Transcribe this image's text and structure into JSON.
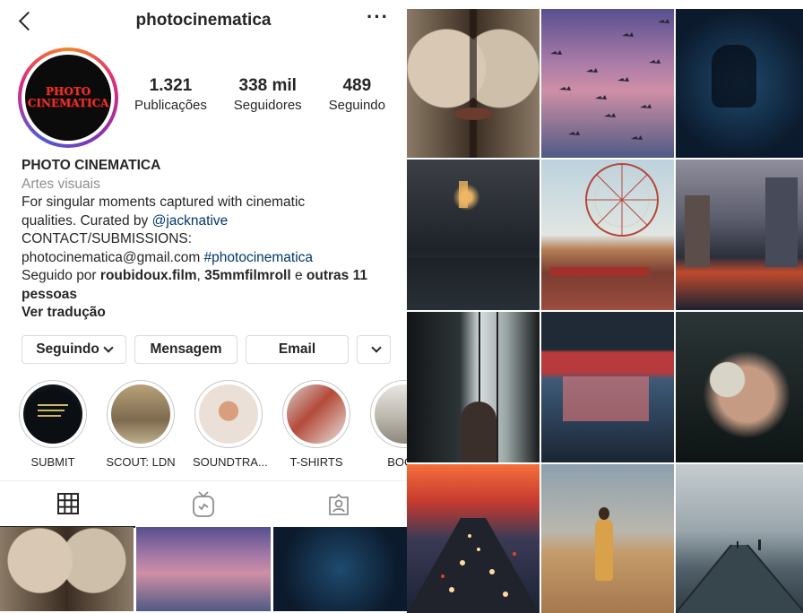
{
  "header": {
    "username": "photocinematica",
    "more_label": "···"
  },
  "avatar": {
    "logo_line1": "PHOTO",
    "logo_line2": "CINEMATICA"
  },
  "stats": [
    {
      "value": "1.321",
      "label": "Publicações"
    },
    {
      "value": "338 mil",
      "label": "Seguidores"
    },
    {
      "value": "489",
      "label": "Seguindo"
    }
  ],
  "bio": {
    "name": "PHOTO CINEMATICA",
    "category": "Artes visuais",
    "line1": "For singular moments captured with cinematic",
    "line2_prefix": "qualities. Curated by ",
    "mention": "@jacknative",
    "line3": "CONTACT/SUBMISSIONS:",
    "email": "photocinematica@gmail.com ",
    "hashtag": "#photocinematica",
    "followed_prefix": "Seguido por ",
    "follower1": "roubidoux.film",
    "sep": ", ",
    "follower2": "35mmfilmroll",
    "and": " e ",
    "others": "outras 11 pessoas",
    "translate": "Ver tradução"
  },
  "buttons": {
    "following": "Seguindo",
    "message": "Mensagem",
    "email": "Email"
  },
  "highlights": [
    {
      "label": "SUBMIT"
    },
    {
      "label": "SCOUT: LDN"
    },
    {
      "label": "SOUNDTRA..."
    },
    {
      "label": "T-SHIRTS"
    },
    {
      "label": "BOOK"
    }
  ],
  "tabs": [
    {
      "icon": "grid-icon"
    },
    {
      "icon": "igtv-icon"
    },
    {
      "icon": "tagged-icon"
    }
  ],
  "colors": {
    "link": "#00376b",
    "muted": "#8e8e8e",
    "text": "#262626",
    "logo_red": "#e8332a"
  }
}
